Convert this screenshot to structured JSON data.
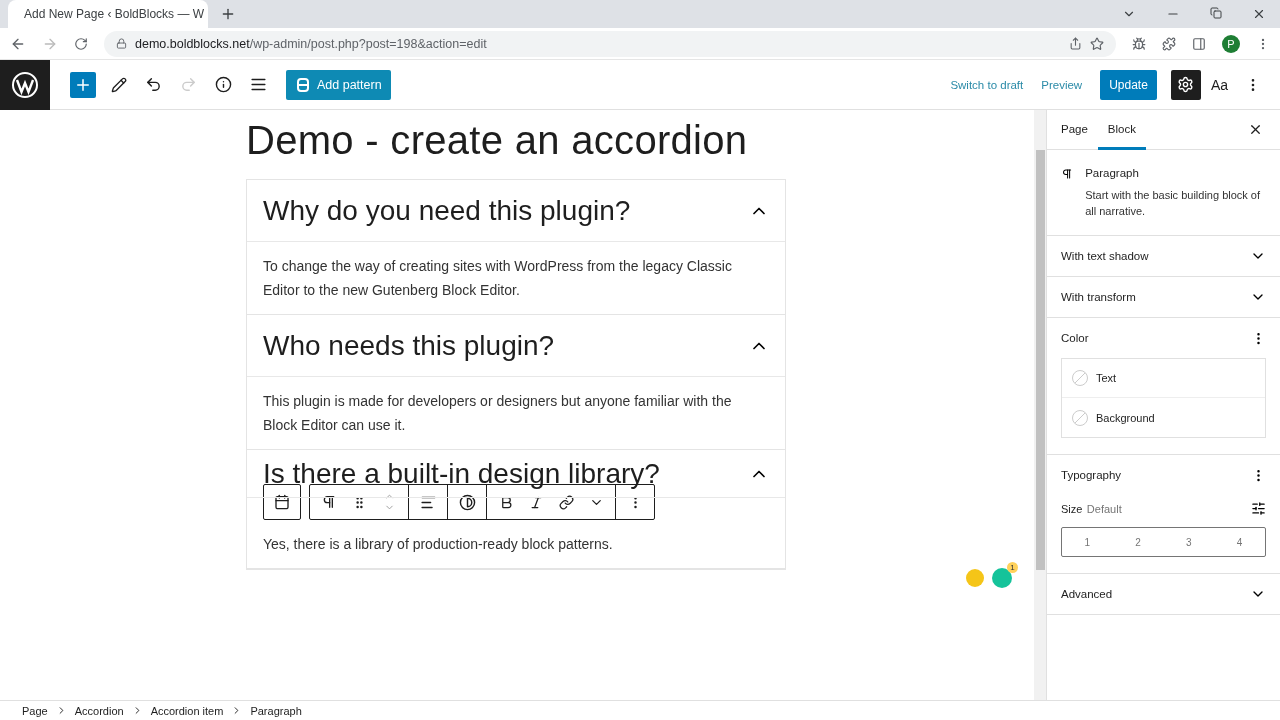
{
  "browser": {
    "tab_title": "Add New Page ‹ BoldBlocks — W",
    "url_host": "demo.boldblocks.net",
    "url_path": "/wp-admin/post.php?post=198&action=edit",
    "profile_initial": "P"
  },
  "toolbar": {
    "add_pattern": "Add pattern",
    "switch_to_draft": "Switch to draft",
    "preview": "Preview",
    "update": "Update",
    "settings_selected": true,
    "styles_label": "Aa"
  },
  "post_title": "Demo - create an accordion",
  "accordion": [
    {
      "heading": "Why do you need this plugin?",
      "expanded": true,
      "body": "To change the way of creating sites with WordPress from the legacy Classic Editor to the new Gutenberg Block Editor."
    },
    {
      "heading": "Who needs this plugin?",
      "expanded": true,
      "body": "This plugin is made for developers or designers but anyone familiar with the Block Editor can use it."
    },
    {
      "heading": "Is there a built-in design library?",
      "expanded": true,
      "body": "Yes, there is a library of production-ready block patterns."
    }
  ],
  "sidebar": {
    "tabs": [
      {
        "label": "Page",
        "selected": false
      },
      {
        "label": "Block",
        "selected": true
      }
    ],
    "block_name": "Paragraph",
    "block_description": "Start with the basic building block of all narrative.",
    "panels": [
      {
        "kind": "toggle",
        "title": "With text shadow",
        "expanded": false
      },
      {
        "kind": "toggle",
        "title": "With transform",
        "expanded": false
      },
      {
        "kind": "color",
        "title": "Color",
        "options": [
          "Text",
          "Background"
        ]
      },
      {
        "kind": "typography",
        "title": "Typography",
        "size_label": "Size",
        "size_value": "Default",
        "sizes": [
          "1",
          "2",
          "3",
          "4"
        ]
      },
      {
        "kind": "toggle",
        "title": "Advanced",
        "expanded": false
      }
    ]
  },
  "grammarly_badge": "1",
  "breadcrumbs": [
    "Page",
    "Accordion",
    "Accordion item",
    "Paragraph"
  ]
}
